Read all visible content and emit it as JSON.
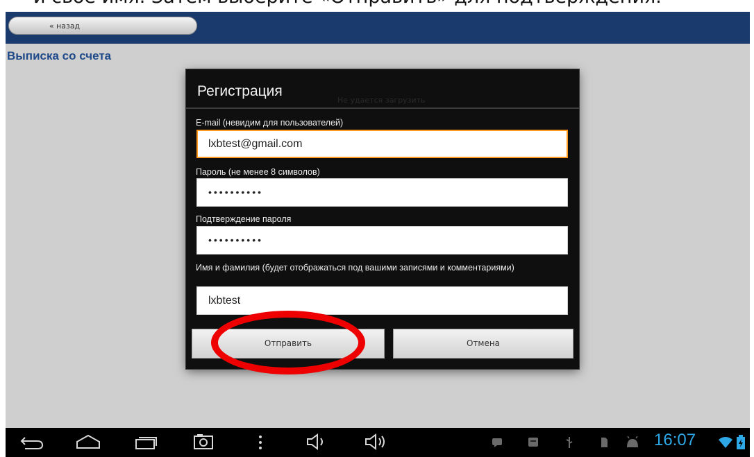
{
  "caption": "и своё имя. Затем выберите «Отправить» для подтверждения.",
  "topbar": {
    "back_label": "« назад"
  },
  "page": {
    "title": "Выписка со счета",
    "background_message": "Не удается загрузить"
  },
  "dialog": {
    "title": "Регистрация",
    "fields": {
      "email": {
        "label": "E-mail (невидим для пользователей)",
        "value": "lxbtest@gmail.com",
        "focused": true
      },
      "password": {
        "label": "Пароль (не менее 8 символов)",
        "value": "••••••••••"
      },
      "password_confirm": {
        "label": "Подтверждение пароля",
        "value": "••••••••••"
      },
      "name": {
        "label": "Имя и фамилия (будет отображаться под вашими записями и комментариями)",
        "value": "lxbtest"
      }
    },
    "buttons": {
      "submit": "Отправить",
      "cancel": "Отмена"
    }
  },
  "status_bar": {
    "time": "16:07",
    "nav_icons": [
      "back-icon",
      "home-icon",
      "recent-apps-icon",
      "screenshot-icon",
      "menu-icon",
      "volume-down-icon",
      "volume-up-icon"
    ],
    "status_icons": [
      "chat-notification-icon",
      "notification-icon",
      "usb-icon",
      "sd-card-icon",
      "android-debug-icon",
      "wifi-icon",
      "battery-icon"
    ]
  },
  "colors": {
    "topbar": "#1a3a6e",
    "page_title": "#1f4a8a",
    "dialog_bg": "#0f0f0f",
    "focus_border": "#ff9a1e",
    "highlight_ring": "#ee0000",
    "clock": "#2ea8e6"
  }
}
